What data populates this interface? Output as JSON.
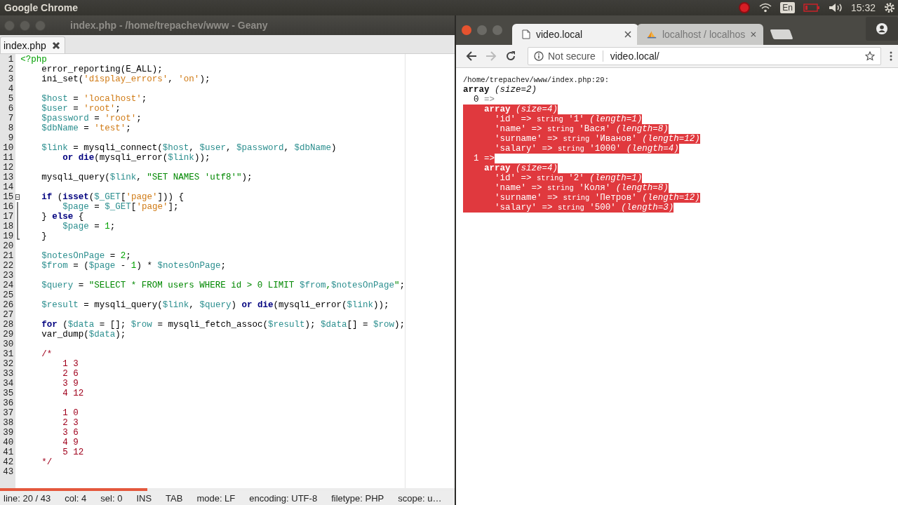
{
  "top_bar": {
    "title": "Google Chrome",
    "language": "En",
    "time": "15:32"
  },
  "geany": {
    "title": "index.php - /home/trepachev/www - Geany",
    "tabs": [
      {
        "label": "index.php",
        "selected": true
      }
    ],
    "lines": [
      {
        "number": "1",
        "tokens": [
          {
            "kind": "tag",
            "text": "<?php"
          }
        ]
      },
      {
        "number": "2",
        "tokens": [
          {
            "kind": "plain",
            "text": "    error_reporting(E_ALL);"
          }
        ]
      },
      {
        "number": "3",
        "tokens": [
          {
            "kind": "plain",
            "text": "    ini_set("
          },
          {
            "kind": "str",
            "text": "'display_errors'"
          },
          {
            "kind": "plain",
            "text": ", "
          },
          {
            "kind": "str",
            "text": "'on'"
          },
          {
            "kind": "plain",
            "text": ");"
          }
        ]
      },
      {
        "number": "4"
      },
      {
        "number": "5",
        "tokens": [
          {
            "kind": "var",
            "text": "    $host"
          },
          {
            "kind": "plain",
            "text": " = "
          },
          {
            "kind": "str",
            "text": "'localhost'"
          },
          {
            "kind": "plain",
            "text": ";"
          }
        ]
      },
      {
        "number": "6",
        "tokens": [
          {
            "kind": "var",
            "text": "    $user"
          },
          {
            "kind": "plain",
            "text": " = "
          },
          {
            "kind": "str",
            "text": "'root'"
          },
          {
            "kind": "plain",
            "text": ";"
          }
        ]
      },
      {
        "number": "7",
        "tokens": [
          {
            "kind": "var",
            "text": "    $password"
          },
          {
            "kind": "plain",
            "text": " = "
          },
          {
            "kind": "str",
            "text": "'root'"
          },
          {
            "kind": "plain",
            "text": ";"
          }
        ]
      },
      {
        "number": "8",
        "tokens": [
          {
            "kind": "var",
            "text": "    $dbName"
          },
          {
            "kind": "plain",
            "text": " = "
          },
          {
            "kind": "str",
            "text": "'test'"
          },
          {
            "kind": "plain",
            "text": ";"
          }
        ]
      },
      {
        "number": "9"
      },
      {
        "number": "10",
        "tokens": [
          {
            "kind": "var",
            "text": "    $link"
          },
          {
            "kind": "plain",
            "text": " = mysqli_connect("
          },
          {
            "kind": "var",
            "text": "$host"
          },
          {
            "kind": "plain",
            "text": ", "
          },
          {
            "kind": "var",
            "text": "$user"
          },
          {
            "kind": "plain",
            "text": ", "
          },
          {
            "kind": "var",
            "text": "$password"
          },
          {
            "kind": "plain",
            "text": ", "
          },
          {
            "kind": "var",
            "text": "$dbName"
          },
          {
            "kind": "plain",
            "text": ")"
          }
        ]
      },
      {
        "number": "11",
        "tokens": [
          {
            "kind": "kw",
            "text": "        or "
          },
          {
            "kind": "kw",
            "text": "die"
          },
          {
            "kind": "plain",
            "text": "(mysqli_error("
          },
          {
            "kind": "var",
            "text": "$link"
          },
          {
            "kind": "plain",
            "text": "));"
          }
        ]
      },
      {
        "number": "12"
      },
      {
        "number": "13",
        "tokens": [
          {
            "kind": "plain",
            "text": "    mysqli_query("
          },
          {
            "kind": "var",
            "text": "$link"
          },
          {
            "kind": "plain",
            "text": ", "
          },
          {
            "kind": "dstr",
            "text": "\"SET NAMES 'utf8'\""
          },
          {
            "kind": "plain",
            "text": ");"
          }
        ]
      },
      {
        "number": "14"
      },
      {
        "number": "15",
        "fold_start": true,
        "tokens": [
          {
            "kind": "kw",
            "text": "    if"
          },
          {
            "kind": "plain",
            "text": " ("
          },
          {
            "kind": "kw",
            "text": "isset"
          },
          {
            "kind": "plain",
            "text": "("
          },
          {
            "kind": "var",
            "text": "$_GET"
          },
          {
            "kind": "plain",
            "text": "["
          },
          {
            "kind": "str",
            "text": "'page'"
          },
          {
            "kind": "plain",
            "text": "])) {"
          }
        ]
      },
      {
        "number": "16",
        "in_fold": true,
        "tokens": [
          {
            "kind": "var",
            "text": "        $page"
          },
          {
            "kind": "plain",
            "text": " = "
          },
          {
            "kind": "var",
            "text": "$_GET"
          },
          {
            "kind": "plain",
            "text": "["
          },
          {
            "kind": "str",
            "text": "'page'"
          },
          {
            "kind": "plain",
            "text": "];"
          }
        ]
      },
      {
        "number": "17",
        "in_fold": true,
        "tokens": [
          {
            "kind": "plain",
            "text": "    } "
          },
          {
            "kind": "kw",
            "text": "else"
          },
          {
            "kind": "plain",
            "text": " {"
          }
        ]
      },
      {
        "number": "18",
        "in_fold": true,
        "tokens": [
          {
            "kind": "var",
            "text": "        $page"
          },
          {
            "kind": "plain",
            "text": " = "
          },
          {
            "kind": "num",
            "text": "1"
          },
          {
            "kind": "plain",
            "text": ";"
          }
        ]
      },
      {
        "number": "19",
        "in_fold": true,
        "tokens": [
          {
            "kind": "plain",
            "text": "    }"
          }
        ]
      },
      {
        "number": "20"
      },
      {
        "number": "21",
        "tokens": [
          {
            "kind": "var",
            "text": "    $notesOnPage"
          },
          {
            "kind": "plain",
            "text": " = "
          },
          {
            "kind": "num",
            "text": "2"
          },
          {
            "kind": "plain",
            "text": ";"
          }
        ]
      },
      {
        "number": "22",
        "tokens": [
          {
            "kind": "var",
            "text": "    $from"
          },
          {
            "kind": "plain",
            "text": " = ("
          },
          {
            "kind": "var",
            "text": "$page"
          },
          {
            "kind": "plain",
            "text": " - "
          },
          {
            "kind": "num",
            "text": "1"
          },
          {
            "kind": "plain",
            "text": ") * "
          },
          {
            "kind": "var",
            "text": "$notesOnPage"
          },
          {
            "kind": "plain",
            "text": ";"
          }
        ]
      },
      {
        "number": "23"
      },
      {
        "number": "24",
        "tokens": [
          {
            "kind": "var",
            "text": "    $query"
          },
          {
            "kind": "plain",
            "text": " = "
          },
          {
            "kind": "dstr",
            "text": "\"SELECT * FROM users WHERE id > 0 LIMIT "
          },
          {
            "kind": "var",
            "text": "$from"
          },
          {
            "kind": "dstr",
            "text": ","
          },
          {
            "kind": "var",
            "text": "$notesOnPage"
          },
          {
            "kind": "dstr",
            "text": "\""
          },
          {
            "kind": "plain",
            "text": ";"
          }
        ]
      },
      {
        "number": "25"
      },
      {
        "number": "26",
        "tokens": [
          {
            "kind": "var",
            "text": "    $result"
          },
          {
            "kind": "plain",
            "text": " = mysqli_query("
          },
          {
            "kind": "var",
            "text": "$link"
          },
          {
            "kind": "plain",
            "text": ", "
          },
          {
            "kind": "var",
            "text": "$query"
          },
          {
            "kind": "plain",
            "text": ") "
          },
          {
            "kind": "kw",
            "text": "or die"
          },
          {
            "kind": "plain",
            "text": "(mysqli_error("
          },
          {
            "kind": "var",
            "text": "$link"
          },
          {
            "kind": "plain",
            "text": "));"
          }
        ]
      },
      {
        "number": "27"
      },
      {
        "number": "28",
        "tokens": [
          {
            "kind": "kw",
            "text": "    for"
          },
          {
            "kind": "plain",
            "text": " ("
          },
          {
            "kind": "var",
            "text": "$data"
          },
          {
            "kind": "plain",
            "text": " = []; "
          },
          {
            "kind": "var",
            "text": "$row"
          },
          {
            "kind": "plain",
            "text": " = mysqli_fetch_assoc("
          },
          {
            "kind": "var",
            "text": "$result"
          },
          {
            "kind": "plain",
            "text": "); "
          },
          {
            "kind": "var",
            "text": "$data"
          },
          {
            "kind": "plain",
            "text": "[] = "
          },
          {
            "kind": "var",
            "text": "$row"
          },
          {
            "kind": "plain",
            "text": ");"
          }
        ]
      },
      {
        "number": "29",
        "tokens": [
          {
            "kind": "plain",
            "text": "    var_dump("
          },
          {
            "kind": "var",
            "text": "$data"
          },
          {
            "kind": "plain",
            "text": ");"
          }
        ]
      },
      {
        "number": "30"
      },
      {
        "number": "31",
        "tokens": [
          {
            "kind": "comment",
            "text": "    /*"
          }
        ]
      },
      {
        "number": "32",
        "tokens": [
          {
            "kind": "comment",
            "text": "        1 3"
          }
        ]
      },
      {
        "number": "33",
        "tokens": [
          {
            "kind": "comment",
            "text": "        2 6"
          }
        ]
      },
      {
        "number": "34",
        "tokens": [
          {
            "kind": "comment",
            "text": "        3 9"
          }
        ]
      },
      {
        "number": "35",
        "tokens": [
          {
            "kind": "comment",
            "text": "        4 12"
          }
        ]
      },
      {
        "number": "36"
      },
      {
        "number": "37",
        "tokens": [
          {
            "kind": "comment",
            "text": "        1 0"
          }
        ]
      },
      {
        "number": "38",
        "tokens": [
          {
            "kind": "comment",
            "text": "        2 3"
          }
        ]
      },
      {
        "number": "39",
        "tokens": [
          {
            "kind": "comment",
            "text": "        3 6"
          }
        ]
      },
      {
        "number": "40",
        "tokens": [
          {
            "kind": "comment",
            "text": "        4 9"
          }
        ]
      },
      {
        "number": "41",
        "tokens": [
          {
            "kind": "comment",
            "text": "        5 12"
          }
        ]
      },
      {
        "number": "42",
        "tokens": [
          {
            "kind": "comment",
            "text": "    */"
          }
        ]
      },
      {
        "number": "43"
      }
    ],
    "status_bar": [
      "line: 20 / 43",
      "col: 4",
      "sel: 0",
      "INS",
      "TAB",
      "mode: LF",
      "encoding: UTF-8",
      "filetype: PHP",
      "scope: u…"
    ]
  },
  "browser": {
    "tabs": [
      {
        "title": "video.local",
        "kind": "page",
        "selected": true
      },
      {
        "title": "localhost / localhos",
        "kind": "pma",
        "selected": false
      }
    ],
    "security": "Not secure",
    "url": "video.local/",
    "dump": [
      {
        "selected": false,
        "parts": [
          {
            "kind": "path",
            "text": "/home/trepachev/www/index.php:29:"
          }
        ]
      },
      {
        "selected": false,
        "parts": [
          {
            "kind": "bold",
            "text": "array"
          },
          {
            "kind": "italic",
            "text": " (size=2)"
          }
        ]
      },
      {
        "selected": false,
        "parts": [
          {
            "kind": "plain",
            "text": "  0 "
          },
          {
            "kind": "arrow",
            "text": "=>"
          }
        ]
      },
      {
        "selected": true,
        "parts": [
          {
            "kind": "bold",
            "text": "    array"
          },
          {
            "kind": "italic",
            "text": " (size=4)"
          }
        ]
      },
      {
        "selected": true,
        "parts": [
          {
            "kind": "plain",
            "text": "      'id' => "
          },
          {
            "kind": "type",
            "text": "string"
          },
          {
            "kind": "plain",
            "text": " '1'"
          },
          {
            "kind": "italic",
            "text": " (length=1)"
          }
        ]
      },
      {
        "selected": true,
        "parts": [
          {
            "kind": "plain",
            "text": "      'name' => "
          },
          {
            "kind": "type",
            "text": "string"
          },
          {
            "kind": "plain",
            "text": " 'Вася'"
          },
          {
            "kind": "italic",
            "text": " (length=8)"
          }
        ]
      },
      {
        "selected": true,
        "parts": [
          {
            "kind": "plain",
            "text": "      'surname' => "
          },
          {
            "kind": "type",
            "text": "string"
          },
          {
            "kind": "plain",
            "text": " 'Иванов'"
          },
          {
            "kind": "italic",
            "text": " (length=12)"
          }
        ]
      },
      {
        "selected": true,
        "parts": [
          {
            "kind": "plain",
            "text": "      'salary' => "
          },
          {
            "kind": "type",
            "text": "string"
          },
          {
            "kind": "plain",
            "text": " '1000'"
          },
          {
            "kind": "italic",
            "text": " (length=4)"
          }
        ]
      },
      {
        "selected": true,
        "parts": [
          {
            "kind": "plain",
            "text": "  1 "
          },
          {
            "kind": "arrow",
            "text": "=>"
          }
        ]
      },
      {
        "selected": true,
        "parts": [
          {
            "kind": "bold",
            "text": "    array"
          },
          {
            "kind": "italic",
            "text": " (size=4)"
          }
        ]
      },
      {
        "selected": true,
        "parts": [
          {
            "kind": "plain",
            "text": "      'id' => "
          },
          {
            "kind": "type",
            "text": "string"
          },
          {
            "kind": "plain",
            "text": " '2'"
          },
          {
            "kind": "italic",
            "text": " (length=1)"
          }
        ]
      },
      {
        "selected": true,
        "parts": [
          {
            "kind": "plain",
            "text": "      'name' => "
          },
          {
            "kind": "type",
            "text": "string"
          },
          {
            "kind": "plain",
            "text": " 'Коля'"
          },
          {
            "kind": "italic",
            "text": " (length=8)"
          }
        ]
      },
      {
        "selected": true,
        "parts": [
          {
            "kind": "plain",
            "text": "      'surname' => "
          },
          {
            "kind": "type",
            "text": "string"
          },
          {
            "kind": "plain",
            "text": " 'Петров'"
          },
          {
            "kind": "italic",
            "text": " (length=12)"
          }
        ]
      },
      {
        "selected": true,
        "parts": [
          {
            "kind": "plain",
            "text": "      'salary' => "
          },
          {
            "kind": "type",
            "text": "string"
          },
          {
            "kind": "plain",
            "text": " '500'"
          },
          {
            "kind": "italic",
            "text": " (length=3)"
          }
        ]
      }
    ]
  }
}
